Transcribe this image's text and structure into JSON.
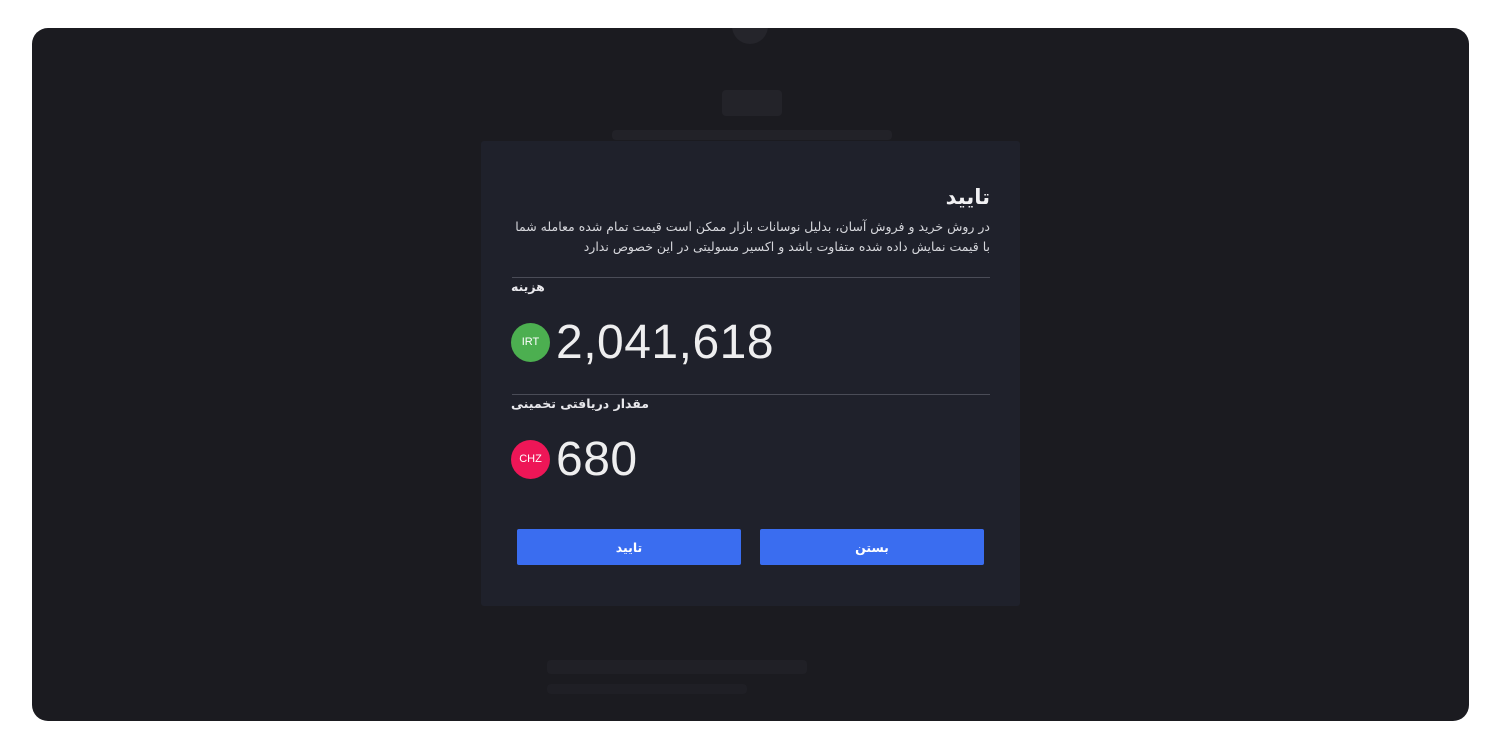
{
  "modal": {
    "title": "تایید",
    "description": "در روش خرید و فروش آسان، بدلیل نوسانات بازار ممکن است قیمت تمام شده معامله شما با قیمت نمایش داده شده متفاوت باشد و اکسیر مسولیتی در این خصوص ندارد",
    "cost": {
      "label": "هزینه",
      "currency": "IRT",
      "currency_color": "#4caf50",
      "amount": "2,041,618"
    },
    "receive": {
      "label": "مقدار دریافتی تخمینی",
      "currency": "CHZ",
      "currency_color": "#ee1657",
      "amount": "680"
    },
    "buttons": {
      "close_label": "بستن",
      "confirm_label": "تایید",
      "color": "#3a6df0"
    }
  }
}
